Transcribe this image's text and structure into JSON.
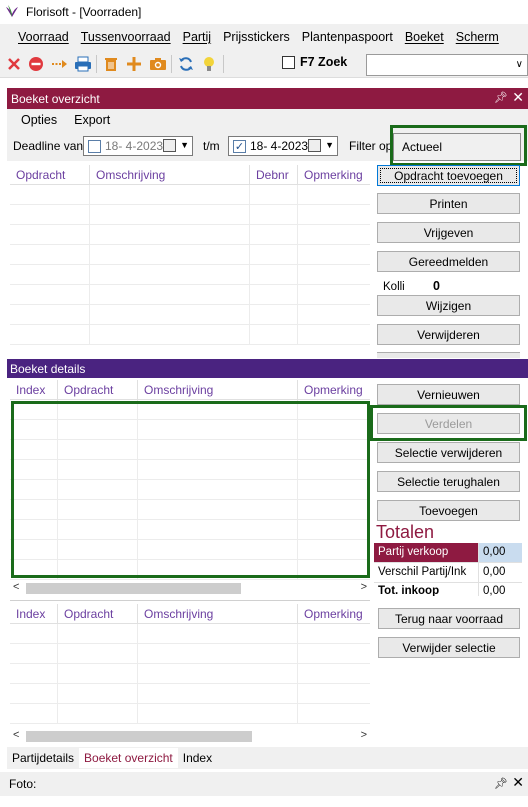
{
  "window": {
    "title": "Florisoft - [Voorraden]"
  },
  "menubar": [
    "Voorraad",
    "Tussenvoorraad",
    "Partij",
    "Prijsstickers",
    "Plantenpaspoort",
    "Boeket",
    "Scherm"
  ],
  "toolbar": {
    "icons": [
      "close-icon",
      "stop-icon",
      "arrow-right-icon",
      "print-icon",
      "trash-icon",
      "add-icon",
      "camera-icon",
      "refresh-icon",
      "lightbulb-icon"
    ],
    "f7_label": "F7 Zoek",
    "zoek_value": ""
  },
  "boeket_overzicht": {
    "title": "Boeket overzicht",
    "menu": [
      "Opties",
      "Export"
    ],
    "deadline_label": "Deadline van",
    "date_from": "18- 4-2023",
    "date_from_checked": false,
    "tm_label": "t/m",
    "date_to": "18- 4-2023",
    "date_to_checked": true,
    "filter_label": "Filter op",
    "filter_value": "Actueel",
    "columns": [
      "Opdracht",
      "Omschrijving",
      "Debnr",
      "Opmerking"
    ],
    "buttons": [
      "Opdracht toevoegen",
      "Printen",
      "Vrijgeven",
      "Gereedmelden",
      "Wijzigen",
      "Verwijderen"
    ],
    "kolli_label": "Kolli",
    "kolli_value": "0"
  },
  "boeket_details": {
    "title": "Boeket details",
    "columns": [
      "Index",
      "Opdracht",
      "Omschrijving",
      "Opmerking"
    ],
    "buttons": [
      "Vernieuwen",
      "Verdelen",
      "Selectie verwijderen",
      "Selectie terughalen",
      "Toevoegen"
    ],
    "totalen_title": "Totalen",
    "totalen": [
      {
        "label": "Partij verkoop",
        "value": "0,00"
      },
      {
        "label": "Verschil Partij/Ink",
        "value": "0,00"
      },
      {
        "label": "Tot. inkoop",
        "value": "0,00"
      }
    ]
  },
  "lower_grid": {
    "columns": [
      "Index",
      "Opdracht",
      "Omschrijving",
      "Opmerking"
    ],
    "buttons": [
      "Terug naar voorraad",
      "Verwijder selectie"
    ]
  },
  "tabs": [
    "Partijdetails",
    "Boeket overzicht",
    "Index"
  ],
  "active_tab": "Boeket overzicht",
  "foto": {
    "label": "Foto:"
  },
  "colors": {
    "panel_header": "#8e1a41",
    "details_header": "#4a2380",
    "highlight_box": "#1a6b1a",
    "column_text": "#6b3fa0"
  }
}
